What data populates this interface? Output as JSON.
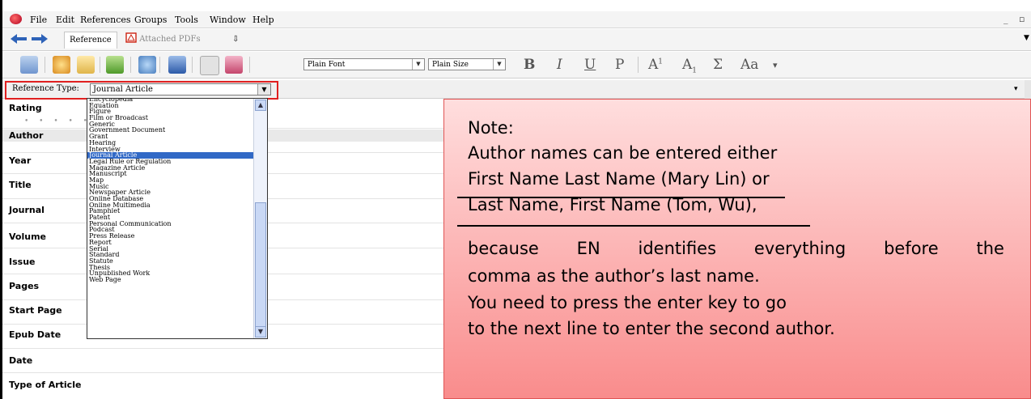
{
  "menu": [
    "File",
    "Edit",
    "References",
    "Groups",
    "Tools",
    "Window",
    "Help"
  ],
  "window_controls": [
    "_",
    "▫"
  ],
  "tabs": {
    "reference": "Reference",
    "attached_pdfs": "Attached PDFs",
    "clip": "⇩"
  },
  "toolbar": {
    "font": "Plain Font",
    "size": "Plain Size",
    "bold": "B",
    "italic": "I",
    "underline": "U",
    "plain": "P",
    "superscript_base": "A",
    "superscript": "1",
    "subscript_base": "A",
    "subscript": "1",
    "sigma": "Σ",
    "case": "Aa",
    "case_menu": "▾"
  },
  "reference_type": {
    "label": "Reference Type:",
    "value": "Journal Article",
    "options_menu": "▾"
  },
  "dropdown_options": [
    "Encyclopedia",
    "Equation",
    "Figure",
    "Film or Broadcast",
    "Generic",
    "Government Document",
    "Grant",
    "Hearing",
    "Interview",
    "Journal Article",
    "Legal Rule or Regulation",
    "Magazine Article",
    "Manuscript",
    "Map",
    "Music",
    "Newspaper Article",
    "Online Database",
    "Online Multimedia",
    "Pamphlet",
    "Patent",
    "Personal Communication",
    "Podcast",
    "Press Release",
    "Report",
    "Serial",
    "Standard",
    "Statute",
    "Thesis",
    "Unpublished Work",
    "Web Page"
  ],
  "selected_option": "Journal Article",
  "fields": [
    "Rating",
    "Author",
    "Year",
    "Title",
    "Journal",
    "Volume",
    "Issue",
    "Pages",
    "Start Page",
    "Epub Date",
    "Date",
    "Type of Article"
  ],
  "rating_dots": "• • • • •",
  "note": {
    "heading": "Note:",
    "line1": "Author names can be entered either",
    "line2": "First Name Last Name (Mary Lin) or",
    "line3": "Last Name, First Name (Tom, Wu),",
    "line4_words": [
      "because",
      "EN",
      "identifies",
      "everything",
      "before",
      "the"
    ],
    "line5": "comma as the author’s last name.",
    "line6": "You need to press the enter key to go",
    "line7": "to the next line to enter the second author."
  },
  "colors": {
    "highlight_box": "#e02020",
    "selected_option": "#3169c6",
    "note_top": "#ffdede",
    "note_bottom": "#f98c8c"
  }
}
